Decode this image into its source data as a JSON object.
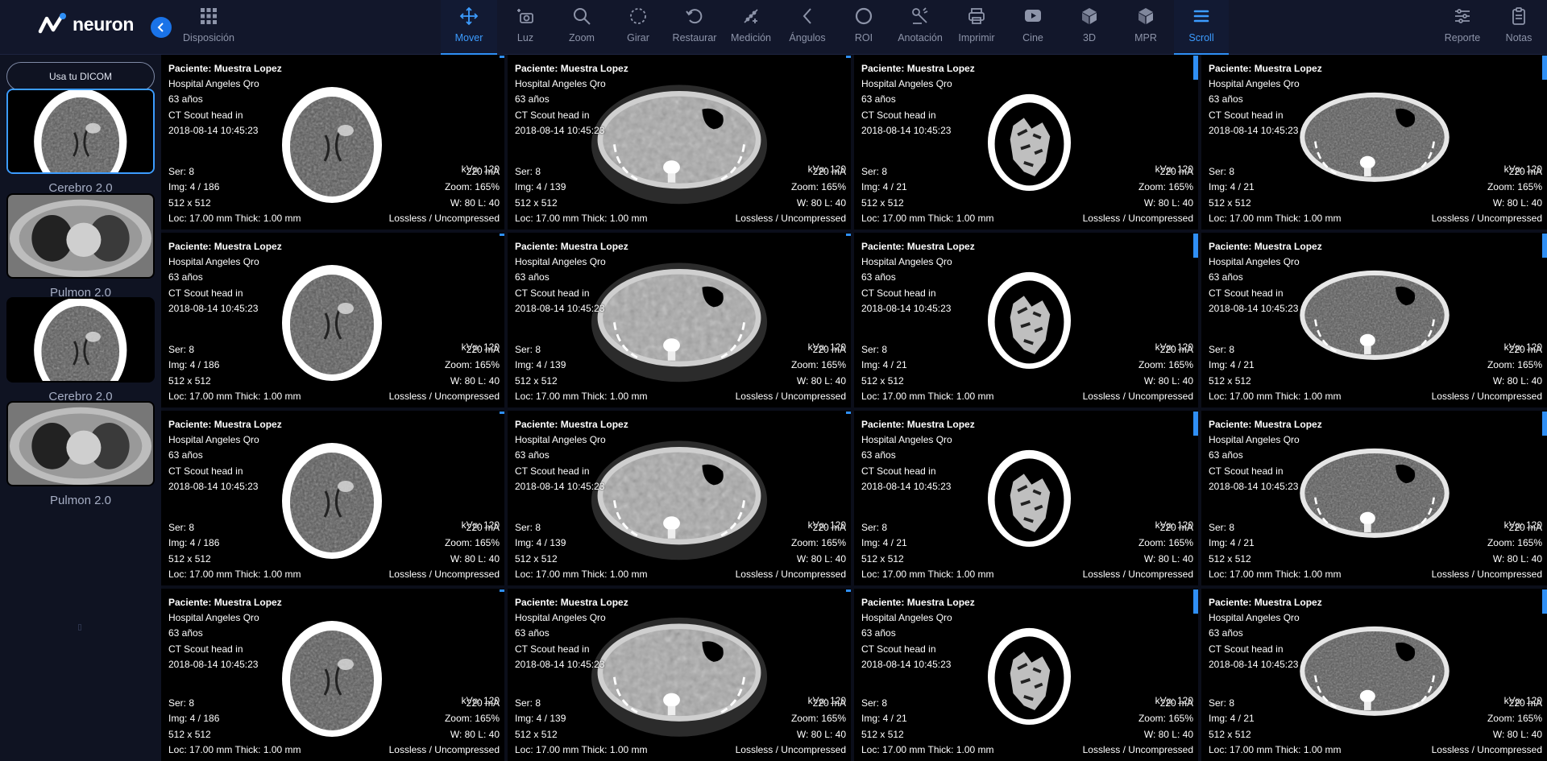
{
  "app": {
    "logo_text": "neuron"
  },
  "toolbar": {
    "layout": {
      "label": "Disposición",
      "icon": "grid-icon"
    },
    "tools": [
      {
        "label": "Mover",
        "icon": "move-icon",
        "active": true
      },
      {
        "label": "Luz",
        "icon": "light-camera-icon"
      },
      {
        "label": "Zoom",
        "icon": "zoom-icon"
      },
      {
        "label": "Girar",
        "icon": "rotate-icon"
      },
      {
        "label": "Restaurar",
        "icon": "restore-icon"
      },
      {
        "label": "Medición",
        "icon": "measure-icon"
      },
      {
        "label": "Ángulos",
        "icon": "angle-icon"
      },
      {
        "label": "ROI",
        "icon": "roi-icon"
      },
      {
        "label": "Anotación",
        "icon": "annotation-icon"
      },
      {
        "label": "Imprimir",
        "icon": "print-icon"
      },
      {
        "label": "Cine",
        "icon": "cine-icon"
      },
      {
        "label": "3D",
        "icon": "cube-icon"
      },
      {
        "label": "MPR",
        "icon": "mpr-icon"
      },
      {
        "label": "Scroll",
        "icon": "scroll-icon",
        "active": true
      }
    ],
    "right": [
      {
        "label": "Reporte",
        "icon": "report-icon"
      },
      {
        "label": "Notas",
        "icon": "notes-icon"
      }
    ]
  },
  "sidebar": {
    "dicom_button": "Usa tu DICOM",
    "studies": [
      {
        "label": "Cerebro 2.0",
        "kind": "brain",
        "selected": true
      },
      {
        "label": "Pulmon 2.0",
        "kind": "chest"
      },
      {
        "label": "Cerebro 2.0",
        "kind": "brain"
      },
      {
        "label": "Pulmon 2.0",
        "kind": "chest"
      }
    ]
  },
  "viewer": {
    "columns": [
      {
        "kind": "brain",
        "img": "Img: 4 / 186"
      },
      {
        "kind": "abdomen-lung",
        "img": "Img: 4 / 139"
      },
      {
        "kind": "spine-small",
        "img": "Img: 4 / 21"
      },
      {
        "kind": "abdomen-soft",
        "img": "Img: 4 / 21"
      }
    ],
    "overlay": {
      "patient": "Paciente: Muestra Lopez",
      "hospital": "Hospital Angeles Qro",
      "age": "63 años",
      "description": "CT Scout head in",
      "datetime": "2018-08-14 10:45:23",
      "series": "Ser: 8",
      "matrix": "512 x 512",
      "location": "Loc: 17.00 mm Thick: 1.00 mm",
      "kvp": "kVp: 120",
      "ma": "220 mA",
      "zoom": "Zoom: 165%",
      "window": "W: 80 L: 40",
      "compression": "Lossless / Uncompressed"
    }
  }
}
